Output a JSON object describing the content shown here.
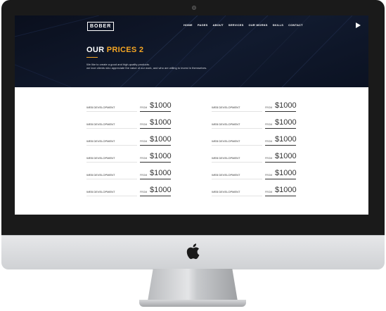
{
  "site": {
    "logo_text": "BOBER",
    "nav": [
      "HOME",
      "PAGES",
      "ABOUT",
      "SERVICES",
      "OUR WORKS",
      "SKILLS",
      "CONTACT"
    ]
  },
  "hero": {
    "title_white": "OUR",
    "title_accent": "PRICES 2",
    "description_line1": "We like to create a good and high-quality products.",
    "description_line2": "we love clients who appreciate the value of our work, and who are willing to invest in themselves."
  },
  "pricing": {
    "left": [
      {
        "service": "WEB DEVELOPMENT",
        "from": "FROM",
        "price": "$1000"
      },
      {
        "service": "WEB DEVELOPMENT",
        "from": "FROM",
        "price": "$1000"
      },
      {
        "service": "WEB DEVELOPMENT",
        "from": "FROM",
        "price": "$1000"
      },
      {
        "service": "WEB DEVELOPMENT",
        "from": "FROM",
        "price": "$1000"
      },
      {
        "service": "WEB DEVELOPMENT",
        "from": "FROM",
        "price": "$1000"
      },
      {
        "service": "WEB DEVELOPMENT",
        "from": "FROM",
        "price": "$1000"
      }
    ],
    "right": [
      {
        "service": "WEB DEVELOPMENT",
        "from": "FROM",
        "price": "$1000"
      },
      {
        "service": "WEB DEVELOPMENT",
        "from": "FROM",
        "price": "$1000"
      },
      {
        "service": "WEB DEVELOPMENT",
        "from": "FROM",
        "price": "$1000"
      },
      {
        "service": "WEB DEVELOPMENT",
        "from": "FROM",
        "price": "$1000"
      },
      {
        "service": "WEB DEVELOPMENT",
        "from": "FROM",
        "price": "$1000"
      },
      {
        "service": "WEB DEVELOPMENT",
        "from": "FROM",
        "price": "$1000"
      }
    ]
  },
  "colors": {
    "accent": "#f5a623",
    "hero_bg": "#0d1426",
    "bezel": "#1a1a1a",
    "chin": "#dcdde0"
  },
  "icons": {
    "play": "play-icon",
    "brand": "apple-logo-icon",
    "camera": "camera-icon"
  }
}
